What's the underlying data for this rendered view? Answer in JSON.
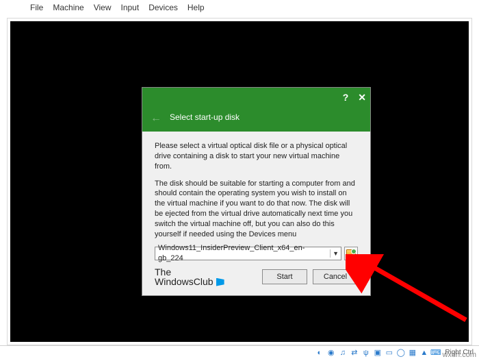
{
  "menubar": {
    "file": "File",
    "machine": "Machine",
    "view": "View",
    "input": "Input",
    "devices": "Devices",
    "help": "Help"
  },
  "dialog": {
    "title": "Select start-up disk",
    "para1": "Please select a virtual optical disk file or a physical optical drive containing a disk to start your new virtual machine from.",
    "para2": "The disk should be suitable for starting a computer from and should contain the operating system you wish to install on the virtual machine if you want to do that now. The disk will be ejected from the virtual drive automatically next time you switch the virtual machine off, but you can also do this yourself if needed using the Devices menu",
    "selected_disk": "Windows11_InsiderPreview_Client_x64_en-gb_224",
    "start_label": "Start",
    "cancel_label": "Cancel",
    "help_glyph": "?",
    "close_glyph": "✕",
    "back_glyph": "←"
  },
  "watermark": {
    "line1": "The",
    "line2": "WindowsClub"
  },
  "statusbar": {
    "right_text": "Right Ctrl"
  },
  "site_watermark": "wxdn.com",
  "status_icons": [
    "hard-disk-icon",
    "optical-disk-icon",
    "audio-icon",
    "network-icon",
    "usb-icon",
    "shared-folder-icon",
    "display-icon",
    "recording-icon",
    "cpu-icon",
    "mouse-icon",
    "keyboard-icon"
  ]
}
